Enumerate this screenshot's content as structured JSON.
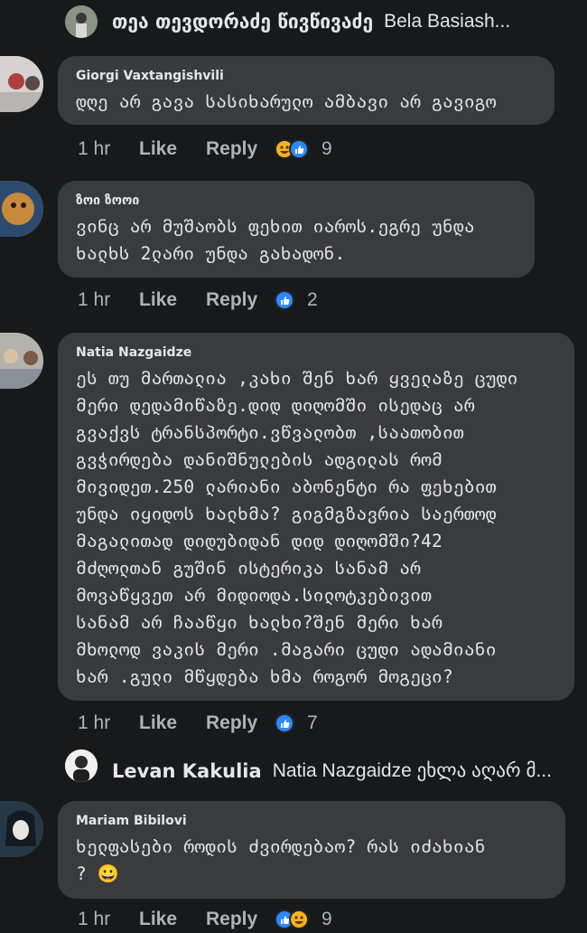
{
  "top_reply": {
    "author": "თეა თევდორაძე წივწივაძე",
    "text": "Bela Basiash..."
  },
  "comments": [
    {
      "author": "Giorgi Vaxtangishvili",
      "lines": [
        "დღე არ გავა სასიხარულო ამბავი არ გავიგო"
      ],
      "time": "1 hr",
      "like": "Like",
      "reply": "Reply",
      "reactions": [
        "haha",
        "like"
      ],
      "count": "9"
    },
    {
      "author": "ზოი ზოოი",
      "lines": [
        "ვინც არ მუშაობს ფეხით იაროს.ეგრე უნდა",
        "ხალხს 2ლარი უნდა გახადონ."
      ],
      "time": "1 hr",
      "like": "Like",
      "reply": "Reply",
      "reactions": [
        "like"
      ],
      "count": "2"
    },
    {
      "author": "Natia Nazgaidze",
      "lines": [
        "ეს თუ მართალია ,კახი შენ ხარ ყველაზე ცუდი",
        "მერი დედამიწაზე.დიდ დიღომში ისედაც არ",
        "გვაქვს ტრანსპორტი.ვწვალობთ ,საათობით",
        "გვჭირდება დანიშნულების ადგილას რომ",
        "მივიდეთ.250 ლარიანი აბონენტი რა ფეხებით",
        "უნდა იყიდოს ხალხმა? გიგმგზავრია საერთოდ",
        "მაგალითად დიდუბიდან დიდ დიღომში?42",
        "მძღოლთან გუშინ ისტერიკა სანამ არ",
        "მოვაწყვეთ არ მიდიოდა.სილოტკებივით",
        "სანამ არ ჩააწყი ხალხი?შენ მერი ხარ",
        "მხოლოდ ვაკის მერი .მაგარი ცუდი ადამიანი",
        "ხარ .გული მწყდება ხმა როგორ მოგეცი?"
      ],
      "time": "1 hr",
      "like": "Like",
      "reply": "Reply",
      "reactions": [
        "like"
      ],
      "count": "7"
    },
    {
      "author": "Mariam Bibilovi",
      "lines": [
        "ხელფასები როდის ძვირდებაო? რას იძახიან",
        "? 😀"
      ],
      "time": "1 hr",
      "like": "Like",
      "reply": "Reply",
      "reactions": [
        "like",
        "haha"
      ],
      "count": "9"
    }
  ],
  "nested_reply": {
    "author": "Levan Kakulia",
    "text": "Natia Nazgaidze ეხლა აღარ მ..."
  },
  "colors": {
    "background": "#18191a",
    "bubble": "#3a3b3c",
    "text": "#e4e6eb",
    "muted": "#b0b3b8",
    "like_blue": "#2d88ff",
    "haha_yellow": "#f7b125"
  }
}
